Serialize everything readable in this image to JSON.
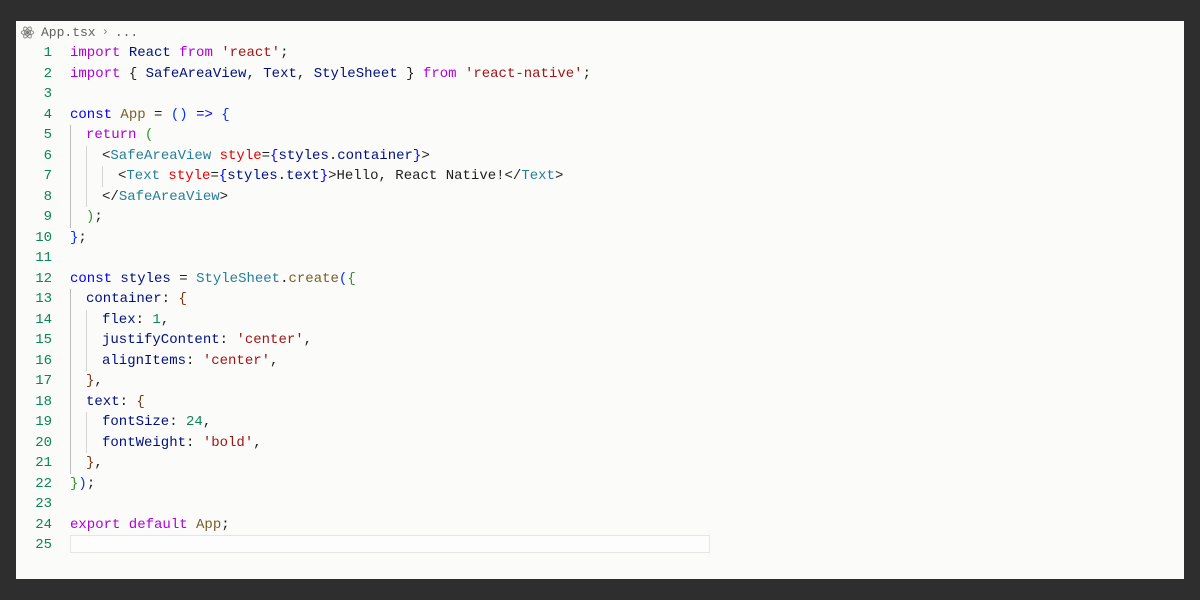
{
  "breadcrumb": {
    "filename": "App.tsx",
    "rest": "..."
  },
  "code": {
    "lines": [
      {
        "n": 1,
        "tokens": [
          [
            "imp",
            "import "
          ],
          [
            "var",
            "React "
          ],
          [
            "imp",
            "from "
          ],
          [
            "str",
            "'react'"
          ],
          [
            "punc",
            ";"
          ]
        ]
      },
      {
        "n": 2,
        "tokens": [
          [
            "imp",
            "import "
          ],
          [
            "punc",
            "{ "
          ],
          [
            "var",
            "SafeAreaView"
          ],
          [
            "punc",
            ", "
          ],
          [
            "var",
            "Text"
          ],
          [
            "punc",
            ", "
          ],
          [
            "var",
            "StyleSheet"
          ],
          [
            "punc",
            " } "
          ],
          [
            "imp",
            "from "
          ],
          [
            "str",
            "'react-native'"
          ],
          [
            "punc",
            ";"
          ]
        ]
      },
      {
        "n": 3,
        "tokens": []
      },
      {
        "n": 4,
        "tokens": [
          [
            "kw",
            "const "
          ],
          [
            "fn",
            "App"
          ],
          [
            "punc",
            " = "
          ],
          [
            "paren",
            "()"
          ],
          [
            "punc",
            " "
          ],
          [
            "kw",
            "=>"
          ],
          [
            "punc",
            " "
          ],
          [
            "paren",
            "{"
          ]
        ]
      },
      {
        "n": 5,
        "indent": 1,
        "tokens": [
          [
            "imp",
            "return "
          ],
          [
            "paren2",
            "("
          ]
        ]
      },
      {
        "n": 6,
        "indent": 2,
        "tokens": [
          [
            "punc",
            "<"
          ],
          [
            "tag",
            "SafeAreaView "
          ],
          [
            "attr",
            "style"
          ],
          [
            "punc",
            "="
          ],
          [
            "kw",
            "{"
          ],
          [
            "var",
            "styles"
          ],
          [
            "punc",
            "."
          ],
          [
            "var",
            "container"
          ],
          [
            "kw",
            "}"
          ],
          [
            "punc",
            ">"
          ]
        ]
      },
      {
        "n": 7,
        "indent": 3,
        "tokens": [
          [
            "punc",
            "<"
          ],
          [
            "tag",
            "Text "
          ],
          [
            "attr",
            "style"
          ],
          [
            "punc",
            "="
          ],
          [
            "kw",
            "{"
          ],
          [
            "var",
            "styles"
          ],
          [
            "punc",
            "."
          ],
          [
            "var",
            "text"
          ],
          [
            "kw",
            "}"
          ],
          [
            "punc",
            ">"
          ],
          [
            "punc",
            "Hello, React Native!"
          ],
          [
            "punc",
            "</"
          ],
          [
            "tag",
            "Text"
          ],
          [
            "punc",
            ">"
          ]
        ]
      },
      {
        "n": 8,
        "indent": 2,
        "tokens": [
          [
            "punc",
            "</"
          ],
          [
            "tag",
            "SafeAreaView"
          ],
          [
            "punc",
            ">"
          ]
        ]
      },
      {
        "n": 9,
        "indent": 1,
        "tokens": [
          [
            "paren2",
            ")"
          ],
          [
            "punc",
            ";"
          ]
        ]
      },
      {
        "n": 10,
        "tokens": [
          [
            "paren",
            "}"
          ],
          [
            "punc",
            ";"
          ]
        ]
      },
      {
        "n": 11,
        "tokens": []
      },
      {
        "n": 12,
        "tokens": [
          [
            "kw",
            "const "
          ],
          [
            "var",
            "styles"
          ],
          [
            "punc",
            " = "
          ],
          [
            "cls",
            "StyleSheet"
          ],
          [
            "punc",
            "."
          ],
          [
            "fn",
            "create"
          ],
          [
            "paren",
            "("
          ],
          [
            "paren2",
            "{"
          ]
        ]
      },
      {
        "n": 13,
        "indent": 1,
        "tokens": [
          [
            "var",
            "container"
          ],
          [
            "punc",
            ": "
          ],
          [
            "brkt",
            "{"
          ]
        ]
      },
      {
        "n": 14,
        "indent": 2,
        "tokens": [
          [
            "var",
            "flex"
          ],
          [
            "punc",
            ": "
          ],
          [
            "num",
            "1"
          ],
          [
            "punc",
            ","
          ]
        ]
      },
      {
        "n": 15,
        "indent": 2,
        "tokens": [
          [
            "var",
            "justifyContent"
          ],
          [
            "punc",
            ": "
          ],
          [
            "str",
            "'center'"
          ],
          [
            "punc",
            ","
          ]
        ]
      },
      {
        "n": 16,
        "indent": 2,
        "tokens": [
          [
            "var",
            "alignItems"
          ],
          [
            "punc",
            ": "
          ],
          [
            "str",
            "'center'"
          ],
          [
            "punc",
            ","
          ]
        ]
      },
      {
        "n": 17,
        "indent": 1,
        "tokens": [
          [
            "brkt",
            "}"
          ],
          [
            "punc",
            ","
          ]
        ]
      },
      {
        "n": 18,
        "indent": 1,
        "tokens": [
          [
            "var",
            "text"
          ],
          [
            "punc",
            ": "
          ],
          [
            "brkt",
            "{"
          ]
        ]
      },
      {
        "n": 19,
        "indent": 2,
        "tokens": [
          [
            "var",
            "fontSize"
          ],
          [
            "punc",
            ": "
          ],
          [
            "num",
            "24"
          ],
          [
            "punc",
            ","
          ]
        ]
      },
      {
        "n": 20,
        "indent": 2,
        "tokens": [
          [
            "var",
            "fontWeight"
          ],
          [
            "punc",
            ": "
          ],
          [
            "str",
            "'bold'"
          ],
          [
            "punc",
            ","
          ]
        ]
      },
      {
        "n": 21,
        "indent": 1,
        "tokens": [
          [
            "brkt",
            "}"
          ],
          [
            "punc",
            ","
          ]
        ]
      },
      {
        "n": 22,
        "tokens": [
          [
            "paren2",
            "}"
          ],
          [
            "paren",
            ")"
          ],
          [
            "punc",
            ";"
          ]
        ]
      },
      {
        "n": 23,
        "tokens": []
      },
      {
        "n": 24,
        "tokens": [
          [
            "imp",
            "export default "
          ],
          [
            "fn",
            "App"
          ],
          [
            "punc",
            ";"
          ]
        ]
      },
      {
        "n": 25,
        "tokens": [],
        "cursor": true
      }
    ]
  }
}
